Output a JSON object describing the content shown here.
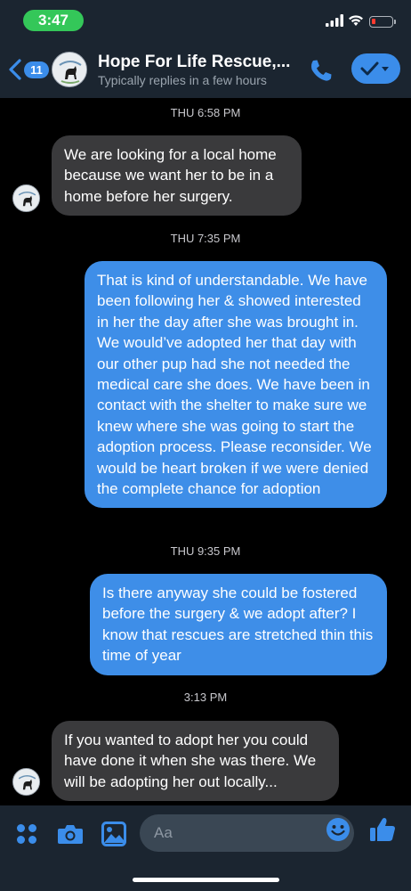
{
  "status_bar": {
    "time": "3:47",
    "accent_color": "#34c759",
    "battery_color": "#ff3b30",
    "icons": [
      "signal-icon",
      "wifi-icon",
      "battery-icon"
    ]
  },
  "header": {
    "back_count": "11",
    "title": "Hope For Life Rescue,...",
    "subtitle": "Typically replies in a few hours",
    "accent_color": "#3b8dea",
    "icons": [
      "back-chevron-icon",
      "phone-icon",
      "checkmark-icon",
      "chevron-down-icon"
    ]
  },
  "messages": [
    {
      "type": "timestamp",
      "text": "THU 6:58 PM"
    },
    {
      "type": "incoming",
      "text": "We are looking for a local home because we want her to be in a home before her surgery."
    },
    {
      "type": "timestamp",
      "text": "THU 7:35 PM"
    },
    {
      "type": "outgoing",
      "text": "That is kind of understandable. We have been following her & showed interested in her the day after she was brought in. We would’ve adopted her that day with our other pup had she not needed the medical care she does. We have been in contact with the shelter to make sure we knew where she was going to start the adoption process. Please reconsider. We would be heart broken if we were denied the complete chance for adoption"
    },
    {
      "type": "timestamp",
      "text": "THU 9:35 PM"
    },
    {
      "type": "outgoing",
      "text": "Is there anyway she could be fostered before the surgery & we adopt after? I know that rescues are stretched thin this time of year"
    },
    {
      "type": "timestamp",
      "text": "3:13 PM"
    },
    {
      "type": "incoming",
      "text": "If you wanted to adopt her you could have done it when she was there. We will be adopting her out locally..."
    }
  ],
  "composer": {
    "placeholder": "Aa",
    "icons": [
      "apps-icon",
      "camera-icon",
      "photo-icon",
      "emoji-icon",
      "thumbs-up-icon"
    ]
  }
}
